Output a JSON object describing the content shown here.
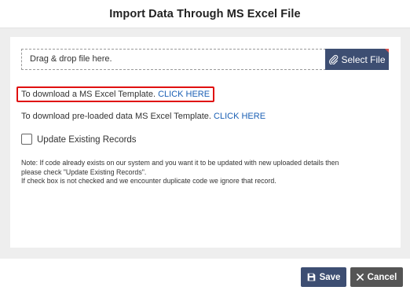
{
  "modal": {
    "title": "Import Data Through MS Excel File"
  },
  "upload": {
    "dropzone_text": "Drag & drop file here.",
    "select_file_label": "Select File",
    "select_file_icon": "paperclip-icon"
  },
  "template_download": {
    "text": "To download a MS Excel Template.",
    "link": "CLICK HERE",
    "highlight_color": "#e01010"
  },
  "preloaded_download": {
    "text": "To download pre-loaded data MS Excel Template.",
    "link": "CLICK HERE"
  },
  "update_existing": {
    "label": "Update Existing Records",
    "checked": false
  },
  "note": {
    "line1": "Note: If code already exists on our system and you want it to be updated with new uploaded details then",
    "line2": "please check \"Update Existing Records\".",
    "line3": "If check box is not checked and we encounter duplicate code we ignore that record."
  },
  "footer": {
    "save_label": "Save",
    "save_icon": "floppy-disk-icon",
    "cancel_label": "Cancel",
    "cancel_icon": "close-icon"
  },
  "colors": {
    "primary": "#3d4e72",
    "secondary": "#555555",
    "link": "#1a5fb4"
  }
}
